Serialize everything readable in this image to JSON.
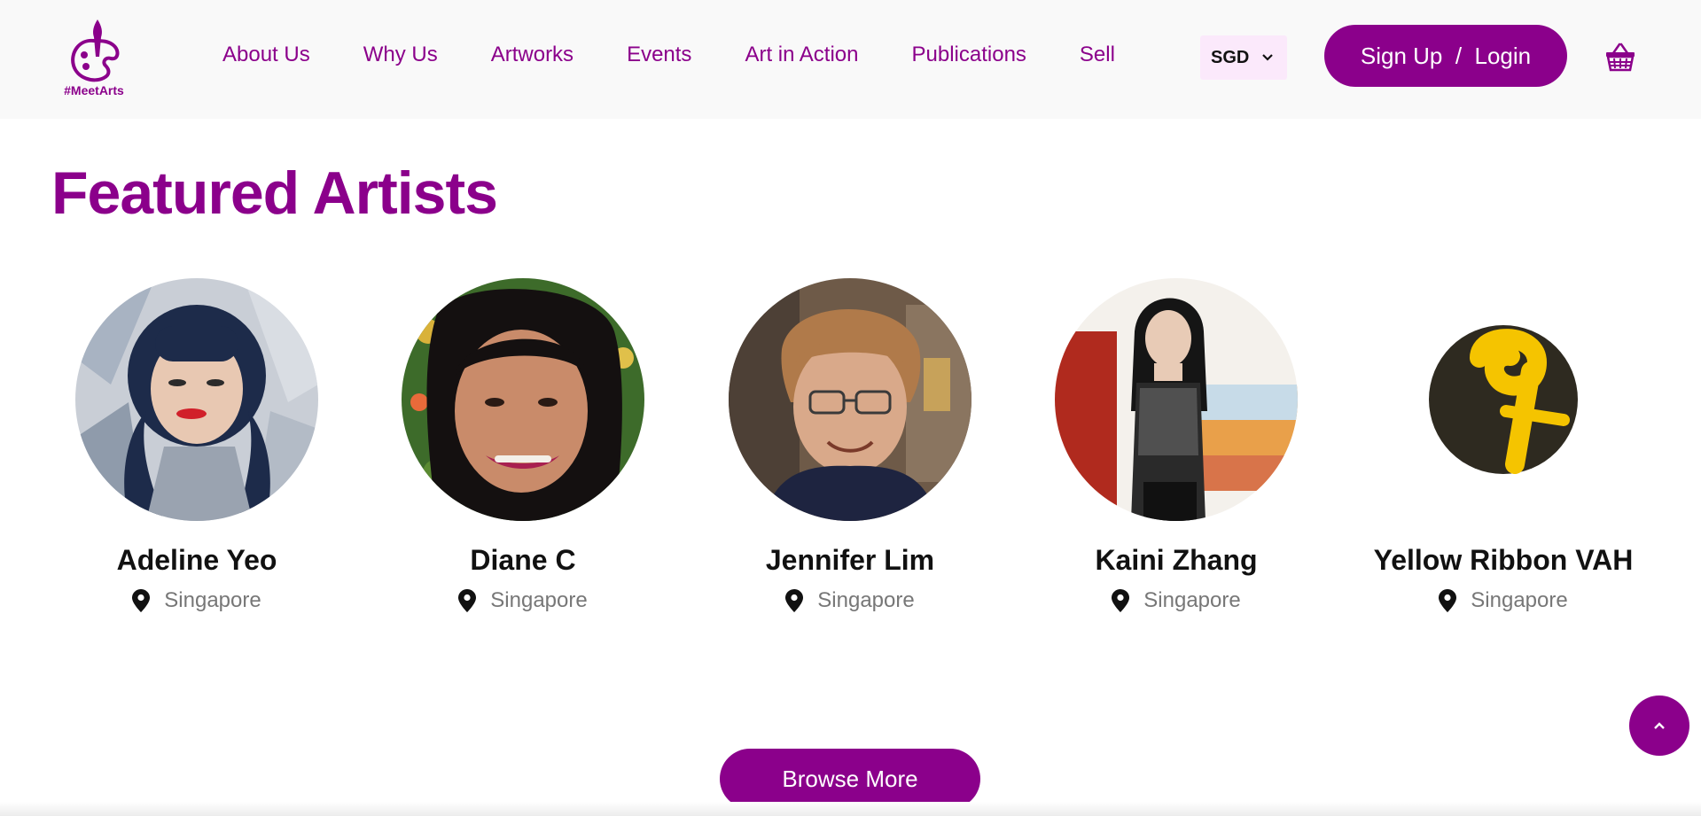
{
  "brand": {
    "logo_text": "#MeetArts"
  },
  "colors": {
    "accent": "#8b008b",
    "currency_bg": "#fbe9fb",
    "header_bg": "#f9f9f9"
  },
  "nav": {
    "items": [
      {
        "label": "About Us"
      },
      {
        "label": "Why Us"
      },
      {
        "label": "Artworks"
      },
      {
        "label": "Events"
      },
      {
        "label": "Art in Action"
      },
      {
        "label": "Publications"
      },
      {
        "label": "Sell"
      }
    ]
  },
  "currency": {
    "selected": "SGD",
    "icon": "chevron-down-icon"
  },
  "auth": {
    "label": "Sign Up  /  Login"
  },
  "cart": {
    "icon": "basket-icon"
  },
  "featured": {
    "title": "Featured Artists",
    "artists": [
      {
        "name": "Adeline Yeo",
        "location": "Singapore"
      },
      {
        "name": "Diane C",
        "location": "Singapore"
      },
      {
        "name": "Jennifer Lim",
        "location": "Singapore"
      },
      {
        "name": "Kaini Zhang",
        "location": "Singapore"
      },
      {
        "name": "Yellow Ribbon VAH",
        "location": "Singapore"
      }
    ],
    "location_icon": "map-pin-icon"
  },
  "browse_more": {
    "label": "Browse More"
  },
  "scroll_top": {
    "icon": "chevron-up-icon"
  }
}
